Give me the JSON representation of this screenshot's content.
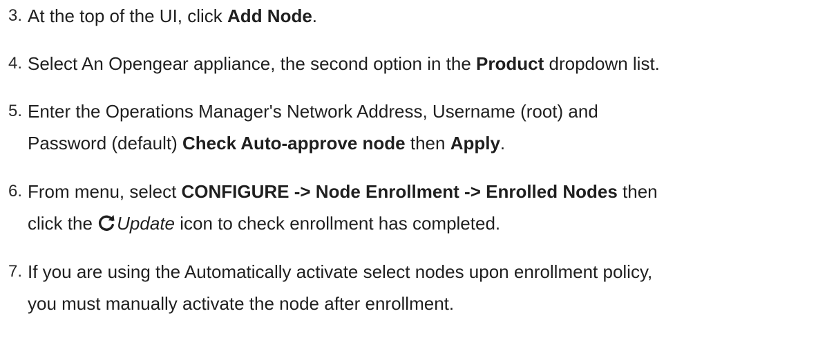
{
  "steps": [
    {
      "number": "3.",
      "lines": [
        {
          "p1": "At the top of the UI, click ",
          "b1": "Add Node",
          "p2": "."
        }
      ]
    },
    {
      "number": "4.",
      "lines": [
        {
          "p1": "Select An Opengear appliance, the second option in the ",
          "b1": "Product",
          "p2": " dropdown list."
        }
      ]
    },
    {
      "number": "5.",
      "lines": [
        {
          "p1": "Enter the Operations Manager's Network Address, Username (root) and"
        },
        {
          "p1": "Password (default) ",
          "b1": "Check Auto-approve node",
          "p2": " then ",
          "b2": "Apply",
          "p3": "."
        }
      ]
    },
    {
      "number": "6.",
      "lines": [
        {
          "p1": "From menu, select ",
          "b1": "CONFIGURE -> Node Enrollment -> Enrolled Nodes",
          "p2": " then"
        },
        {
          "p1": "click the ",
          "icon": "refresh-icon",
          "i1": "Update",
          "p2": " icon to check enrollment has completed."
        }
      ]
    },
    {
      "number": "7.",
      "lines": [
        {
          "p1": "If you are using the Automatically activate select nodes upon enrollment policy,"
        },
        {
          "p1": "you must manually activate the node after enrollment."
        }
      ]
    }
  ]
}
